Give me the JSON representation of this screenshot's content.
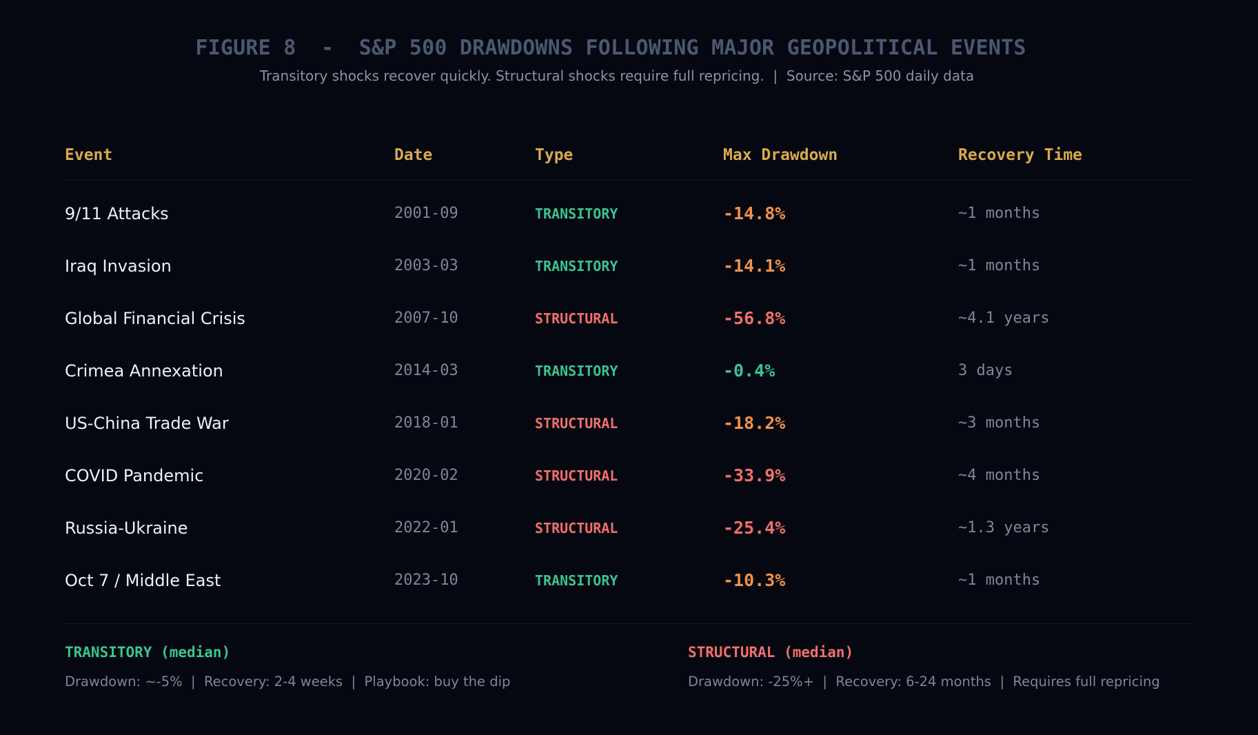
{
  "title": "FIGURE 8  -  S&P 500 DRAWDOWNS FOLLOWING MAJOR GEOPOLITICAL EVENTS",
  "subtitle": "Transitory shocks recover quickly. Structural shocks require full repricing.  |  Source: S&P 500 daily data",
  "colors": {
    "background": "#050811",
    "header": "#d8a94f",
    "transitory": "#3ec28f",
    "structural": "#f0706a",
    "drawdown_moderate": "#f0914a",
    "drawdown_severe": "#f0706a",
    "drawdown_minor": "#3ec28f",
    "muted": "#7d879a",
    "title": "#4b5870"
  },
  "chart_data": {
    "type": "table",
    "columns": [
      "Event",
      "Date",
      "Type",
      "Max Drawdown",
      "Recovery Time"
    ],
    "rows": [
      {
        "event": "9/11 Attacks",
        "date": "2001-09",
        "type": "TRANSITORY",
        "drawdown": "-14.8%",
        "drawdown_value": -14.8,
        "severity": "moderate",
        "recovery": "~1 months"
      },
      {
        "event": "Iraq Invasion",
        "date": "2003-03",
        "type": "TRANSITORY",
        "drawdown": "-14.1%",
        "drawdown_value": -14.1,
        "severity": "moderate",
        "recovery": "~1 months"
      },
      {
        "event": "Global Financial Crisis",
        "date": "2007-10",
        "type": "STRUCTURAL",
        "drawdown": "-56.8%",
        "drawdown_value": -56.8,
        "severity": "severe",
        "recovery": "~4.1 years"
      },
      {
        "event": "Crimea Annexation",
        "date": "2014-03",
        "type": "TRANSITORY",
        "drawdown": "-0.4%",
        "drawdown_value": -0.4,
        "severity": "minor",
        "recovery": "3 days"
      },
      {
        "event": "US-China Trade War",
        "date": "2018-01",
        "type": "STRUCTURAL",
        "drawdown": "-18.2%",
        "drawdown_value": -18.2,
        "severity": "moderate",
        "recovery": "~3 months"
      },
      {
        "event": "COVID Pandemic",
        "date": "2020-02",
        "type": "STRUCTURAL",
        "drawdown": "-33.9%",
        "drawdown_value": -33.9,
        "severity": "severe",
        "recovery": "~4 months"
      },
      {
        "event": "Russia-Ukraine",
        "date": "2022-01",
        "type": "STRUCTURAL",
        "drawdown": "-25.4%",
        "drawdown_value": -25.4,
        "severity": "severe",
        "recovery": "~1.3 years"
      },
      {
        "event": "Oct 7 / Middle East",
        "date": "2023-10",
        "type": "TRANSITORY",
        "drawdown": "-10.3%",
        "drawdown_value": -10.3,
        "severity": "moderate",
        "recovery": "~1 months"
      }
    ]
  },
  "legend": {
    "transitory": {
      "title": "TRANSITORY (median)",
      "description": "Drawdown: ~-5%  |  Recovery: 2-4 weeks  |  Playbook: buy the dip"
    },
    "structural": {
      "title": "STRUCTURAL (median)",
      "description": "Drawdown: -25%+  |  Recovery: 6-24 months  |  Requires full repricing"
    }
  }
}
